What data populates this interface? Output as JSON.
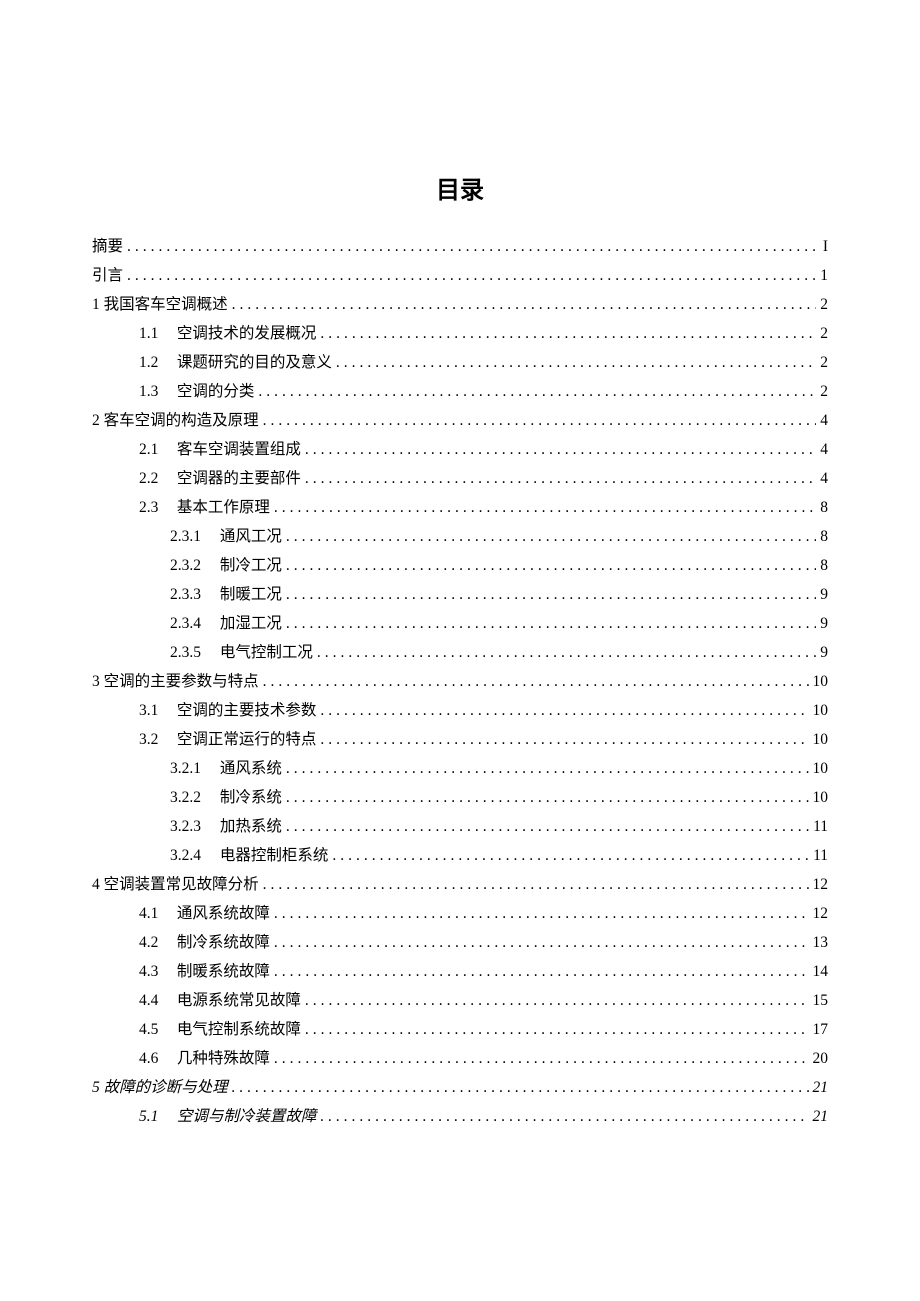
{
  "title": "目录",
  "entries": [
    {
      "indent": 0,
      "num": "",
      "label": "摘要",
      "page": "I",
      "italic": false
    },
    {
      "indent": 0,
      "num": "",
      "label": "引言",
      "page": "1",
      "italic": false
    },
    {
      "indent": 0,
      "num": "",
      "label": "1 我国客车空调概述",
      "page": "2",
      "italic": false
    },
    {
      "indent": 1,
      "num": "1.1",
      "label": "空调技术的发展概况",
      "page": "2",
      "italic": false
    },
    {
      "indent": 1,
      "num": "1.2",
      "label": "课题研究的目的及意义",
      "page": "2",
      "italic": false
    },
    {
      "indent": 1,
      "num": "1.3",
      "label": "空调的分类",
      "page": "2",
      "italic": false
    },
    {
      "indent": 0,
      "num": "",
      "label": "2 客车空调的构造及原理",
      "page": "4",
      "italic": false
    },
    {
      "indent": 1,
      "num": "2.1",
      "label": "客车空调装置组成",
      "page": "4",
      "italic": false
    },
    {
      "indent": 1,
      "num": "2.2",
      "label": "空调器的主要部件",
      "page": "4",
      "italic": false
    },
    {
      "indent": 1,
      "num": "2.3",
      "label": "基本工作原理",
      "page": "8",
      "italic": false
    },
    {
      "indent": 2,
      "num": "2.3.1",
      "label": "通风工况",
      "page": "8",
      "italic": false
    },
    {
      "indent": 2,
      "num": "2.3.2",
      "label": "制冷工况",
      "page": "8",
      "italic": false
    },
    {
      "indent": 2,
      "num": "2.3.3",
      "label": "制暖工况",
      "page": "9",
      "italic": false
    },
    {
      "indent": 2,
      "num": "2.3.4",
      "label": "加湿工况",
      "page": "9",
      "italic": false
    },
    {
      "indent": 2,
      "num": "2.3.5",
      "label": "电气控制工况",
      "page": "9",
      "italic": false
    },
    {
      "indent": 0,
      "num": "",
      "label": "3 空调的主要参数与特点",
      "page": "10",
      "italic": false
    },
    {
      "indent": 1,
      "num": "3.1",
      "label": "空调的主要技术参数",
      "page": "10",
      "italic": false
    },
    {
      "indent": 1,
      "num": "3.2",
      "label": "空调正常运行的特点",
      "page": "10",
      "italic": false
    },
    {
      "indent": 2,
      "num": "3.2.1",
      "label": "通风系统",
      "page": "10",
      "italic": false
    },
    {
      "indent": 2,
      "num": "3.2.2",
      "label": "制冷系统",
      "page": "10",
      "italic": false
    },
    {
      "indent": 2,
      "num": "3.2.3",
      "label": "加热系统",
      "page": "11",
      "italic": false
    },
    {
      "indent": 2,
      "num": "3.2.4",
      "label": "电器控制柜系统",
      "page": "11",
      "italic": false
    },
    {
      "indent": 0,
      "num": "",
      "label": "4 空调装置常见故障分析",
      "page": "12",
      "italic": false
    },
    {
      "indent": 1,
      "num": "4.1",
      "label": "通风系统故障",
      "page": "12",
      "italic": false
    },
    {
      "indent": 1,
      "num": "4.2",
      "label": "制冷系统故障",
      "page": "13",
      "italic": false
    },
    {
      "indent": 1,
      "num": "4.3",
      "label": "制暖系统故障",
      "page": "14",
      "italic": false
    },
    {
      "indent": 1,
      "num": "4.4",
      "label": "电源系统常见故障",
      "page": "15",
      "italic": false
    },
    {
      "indent": 1,
      "num": "4.5",
      "label": "电气控制系统故障",
      "page": "17",
      "italic": false
    },
    {
      "indent": 1,
      "num": "4.6",
      "label": "几种特殊故障",
      "page": "20",
      "italic": false
    },
    {
      "indent": 0,
      "num": "",
      "label": "5 故障的诊断与处理",
      "page": "21",
      "italic": true
    },
    {
      "indent": 1,
      "num": "5.1",
      "label": "空调与制冷装置故障",
      "page": "21",
      "italic": true
    }
  ]
}
